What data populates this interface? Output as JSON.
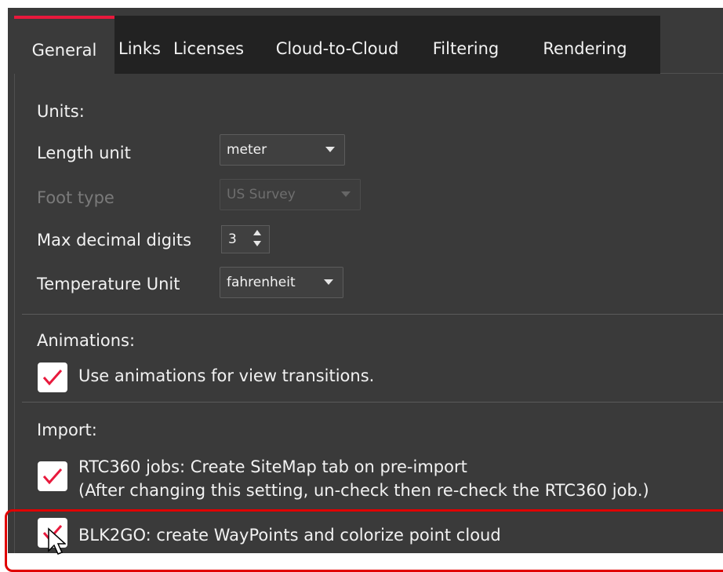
{
  "tabs": [
    {
      "label": "General",
      "active": true
    },
    {
      "label": "Links"
    },
    {
      "label": "Licenses"
    },
    {
      "label": "Cloud-to-Cloud"
    },
    {
      "label": "Filtering"
    },
    {
      "label": "Rendering"
    }
  ],
  "units": {
    "heading": "Units:",
    "length_label": "Length unit",
    "length_value": "meter",
    "foot_label": "Foot type",
    "foot_value": "US Survey",
    "decimals_label": "Max decimal digits",
    "decimals_value": "3",
    "temperature_label": "Temperature Unit",
    "temperature_value": "fahrenheit"
  },
  "animations": {
    "heading": "Animations:",
    "view_transitions_label": "Use animations for view transitions.",
    "view_transitions_checked": true
  },
  "import": {
    "heading": "Import:",
    "rtc360_line1": "RTC360 jobs: Create SiteMap tab on pre-import",
    "rtc360_line2": "(After changing this setting, un-check then re-check the RTC360 job.)",
    "rtc360_checked": true,
    "blk2go_label": "BLK2GO: create WayPoints and colorize point cloud",
    "blk2go_checked": true
  },
  "colors": {
    "accent": "#e8193c",
    "background": "#3a3a3a",
    "tab_strip": "#222222",
    "highlight": "#e00000"
  }
}
